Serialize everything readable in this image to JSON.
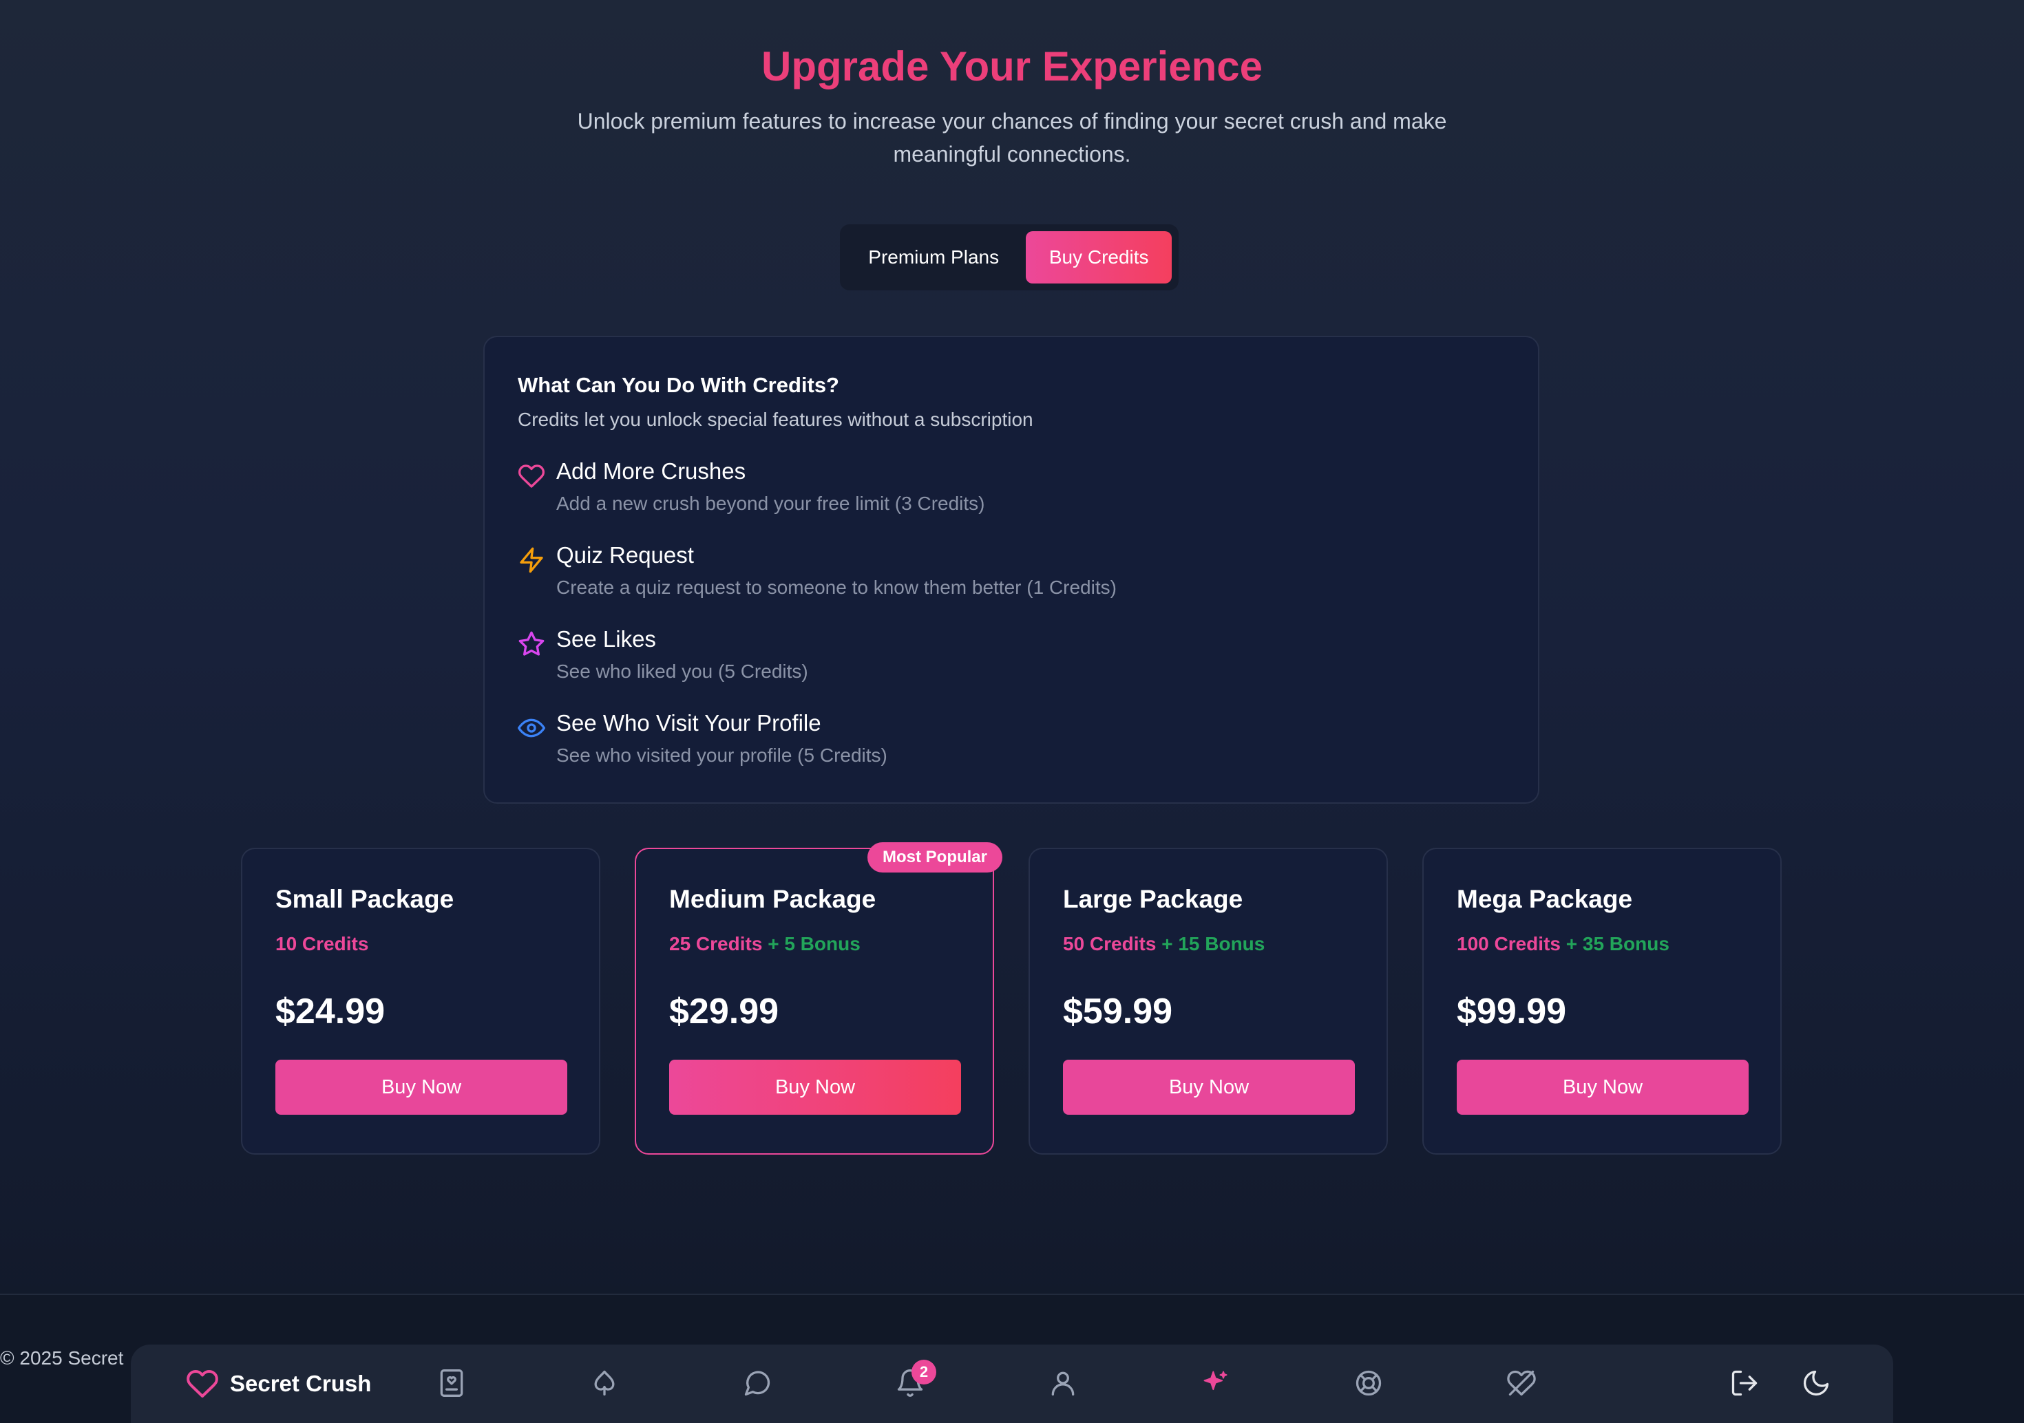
{
  "header": {
    "title": "Upgrade Your Experience",
    "subtitle": "Unlock premium features to increase your chances of finding your secret crush and make meaningful connections."
  },
  "tabs": [
    {
      "label": "Premium Plans",
      "active": false
    },
    {
      "label": "Buy Credits",
      "active": true
    }
  ],
  "info": {
    "title": "What Can You Do With Credits?",
    "subtitle": "Credits let you unlock special features without a subscription",
    "features": [
      {
        "icon": "heart-icon",
        "name": "Add More Crushes",
        "desc": "Add a new crush beyond your free limit (3 Credits)",
        "color": "#ec4899"
      },
      {
        "icon": "lightning-icon",
        "name": "Quiz Request",
        "desc": "Create a quiz request to someone to know them better (1 Credits)",
        "color": "#f59e0b"
      },
      {
        "icon": "star-icon",
        "name": "See Likes",
        "desc": "See who liked you (5 Credits)",
        "color": "#d946ef"
      },
      {
        "icon": "eye-icon",
        "name": "See Who Visit Your Profile",
        "desc": "See who visited your profile (5 Credits)",
        "color": "#3b82f6"
      }
    ]
  },
  "packages": [
    {
      "name": "Small Package",
      "credits": "10 Credits",
      "bonus": "",
      "price": "$24.99",
      "button": "Buy Now",
      "popular": false
    },
    {
      "name": "Medium Package",
      "credits": "25 Credits",
      "bonus": "+ 5 Bonus",
      "price": "$29.99",
      "button": "Buy Now",
      "popular": true,
      "badge": "Most Popular"
    },
    {
      "name": "Large Package",
      "credits": "50 Credits",
      "bonus": "+ 15 Bonus",
      "price": "$59.99",
      "button": "Buy Now",
      "popular": false
    },
    {
      "name": "Mega Package",
      "credits": "100 Credits",
      "bonus": "+ 35 Bonus",
      "price": "$99.99",
      "button": "Buy Now",
      "popular": false
    }
  ],
  "footer": {
    "copyright": "© 2025 Secret"
  },
  "navbar": {
    "brand": "Secret Crush",
    "notifications_count": "2",
    "icons": [
      "profile-card-icon",
      "spade-icon",
      "chat-icon",
      "bell-icon",
      "user-icon",
      "sparkles-icon",
      "lifebuoy-icon",
      "crossed-heart-icon",
      "logout-icon",
      "moon-icon"
    ],
    "accent": "#ec4899"
  }
}
